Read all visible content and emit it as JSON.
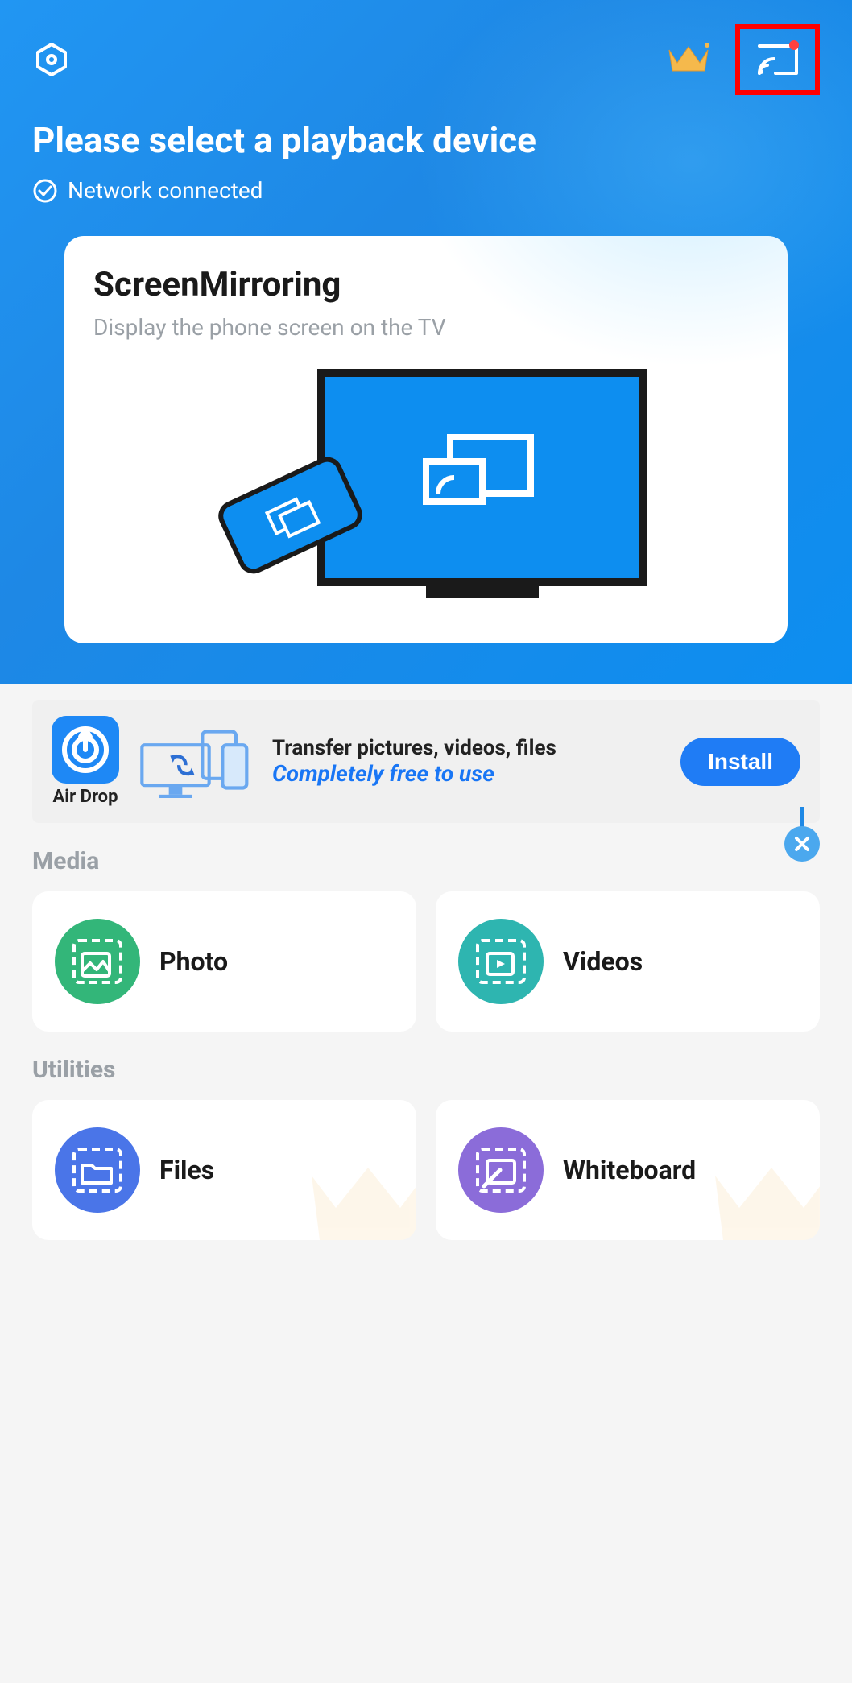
{
  "header": {
    "title": "Please select a playback device",
    "status": "Network connected"
  },
  "mainCard": {
    "title": "ScreenMirroring",
    "subtitle": "Display the phone screen on the TV"
  },
  "banner": {
    "app_label": "Air Drop",
    "line1": "Transfer pictures, videos, files",
    "line2": "Completely free to use",
    "install_label": "Install"
  },
  "sections": {
    "media": {
      "title": "Media",
      "items": [
        {
          "label": "Photo"
        },
        {
          "label": "Videos"
        }
      ]
    },
    "utilities": {
      "title": "Utilities",
      "items": [
        {
          "label": "Files"
        },
        {
          "label": "Whiteboard"
        }
      ]
    }
  }
}
